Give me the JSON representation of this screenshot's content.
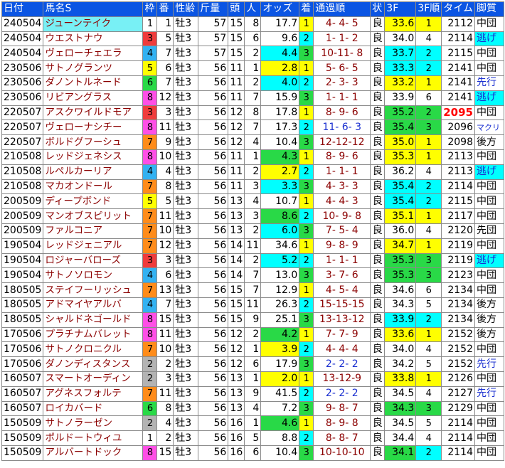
{
  "headers": [
    "日付",
    "馬名S",
    "枠",
    "番",
    "性齢",
    "斤量",
    "頭",
    "人",
    "オッズ",
    "着",
    "通過順",
    "状",
    "3F",
    "3F順",
    "タイム",
    "脚質"
  ],
  "rows": [
    {
      "date": "240504",
      "name": "ジューンテイク",
      "name_hl": true,
      "waku": "1",
      "num": "1",
      "sex": "牡3",
      "kin": "57",
      "tou": "15",
      "jin": "8",
      "odds": "17.7",
      "odds_bg": "",
      "chaku": "1",
      "chaku_bg": "yellow",
      "pass": "4- 4- 5",
      "pass_blue": false,
      "baba": "良",
      "f3": "33.6",
      "f3_bg": "yellow",
      "f3r": "1",
      "f3r_bg": "yellow",
      "time": "2112",
      "time_best": false,
      "style": "中団",
      "style_bg": "",
      "style_blue": false
    },
    {
      "date": "240504",
      "name": "ウエストナウ",
      "name_hl": false,
      "waku": "3",
      "num": "5",
      "sex": "牡3",
      "kin": "57",
      "tou": "15",
      "jin": "6",
      "odds": "9.6",
      "odds_bg": "",
      "chaku": "2",
      "chaku_bg": "cyan",
      "pass": "1- 1- 2",
      "pass_blue": false,
      "baba": "良",
      "f3": "34.0",
      "f3_bg": "",
      "f3r": "4",
      "f3r_bg": "",
      "time": "2114",
      "time_best": false,
      "style": "逃げ",
      "style_bg": "cyan",
      "style_blue": true
    },
    {
      "date": "240504",
      "name": "ヴェローチェエラ",
      "name_hl": false,
      "waku": "4",
      "num": "7",
      "sex": "牡3",
      "kin": "57",
      "tou": "15",
      "jin": "2",
      "odds": "4.4",
      "odds_bg": "cyan",
      "chaku": "3",
      "chaku_bg": "green",
      "pass": "10-11- 8",
      "pass_blue": false,
      "baba": "良",
      "f3": "33.7",
      "f3_bg": "cyan",
      "f3r": "2",
      "f3r_bg": "cyan",
      "time": "2115",
      "time_best": false,
      "style": "中団",
      "style_bg": "",
      "style_blue": false
    },
    {
      "date": "230506",
      "name": "サトノグランツ",
      "name_hl": false,
      "waku": "5",
      "num": "6",
      "sex": "牡3",
      "kin": "56",
      "tou": "11",
      "jin": "1",
      "odds": "2.8",
      "odds_bg": "yellow",
      "chaku": "1",
      "chaku_bg": "yellow",
      "pass": "5- 6- 5",
      "pass_blue": false,
      "baba": "良",
      "f3": "33.3",
      "f3_bg": "cyan",
      "f3r": "2",
      "f3r_bg": "cyan",
      "time": "2141",
      "time_best": false,
      "style": "中団",
      "style_bg": "",
      "style_blue": false
    },
    {
      "date": "230506",
      "name": "ダノントルネード",
      "name_hl": false,
      "waku": "6",
      "num": "7",
      "sex": "牡3",
      "kin": "56",
      "tou": "11",
      "jin": "2",
      "odds": "4.0",
      "odds_bg": "cyan",
      "chaku": "2",
      "chaku_bg": "cyan",
      "pass": "2- 3- 3",
      "pass_blue": false,
      "baba": "良",
      "f3": "33.2",
      "f3_bg": "yellow",
      "f3r": "1",
      "f3r_bg": "yellow",
      "time": "2141",
      "time_best": false,
      "style": "先行",
      "style_bg": "",
      "style_blue": true
    },
    {
      "date": "230506",
      "name": "リビアングラス",
      "name_hl": false,
      "waku": "8",
      "num": "12",
      "sex": "牡3",
      "kin": "56",
      "tou": "11",
      "jin": "7",
      "odds": "15.9",
      "odds_bg": "",
      "chaku": "3",
      "chaku_bg": "green",
      "pass": "1- 1- 1",
      "pass_blue": false,
      "baba": "良",
      "f3": "33.9",
      "f3_bg": "",
      "f3r": "6",
      "f3r_bg": "",
      "time": "2141",
      "time_best": false,
      "style": "逃げ",
      "style_bg": "cyan",
      "style_blue": true
    },
    {
      "date": "220507",
      "name": "アスクワイルドモア",
      "name_hl": false,
      "waku": "3",
      "num": "3",
      "sex": "牡3",
      "kin": "56",
      "tou": "12",
      "jin": "8",
      "odds": "17.8",
      "odds_bg": "",
      "chaku": "1",
      "chaku_bg": "yellow",
      "pass": "8- 9- 6",
      "pass_blue": false,
      "baba": "良",
      "f3": "35.2",
      "f3_bg": "green",
      "f3r": "2",
      "f3r_bg": "green",
      "time": "2095",
      "time_best": true,
      "style": "中団",
      "style_bg": "",
      "style_blue": false
    },
    {
      "date": "220507",
      "name": "ヴェローナシチー",
      "name_hl": false,
      "waku": "8",
      "num": "11",
      "sex": "牡3",
      "kin": "56",
      "tou": "12",
      "jin": "7",
      "odds": "17.3",
      "odds_bg": "",
      "chaku": "2",
      "chaku_bg": "cyan",
      "pass": "11- 6- 3",
      "pass_blue": true,
      "baba": "良",
      "f3": "35.4",
      "f3_bg": "green",
      "f3r": "3",
      "f3r_bg": "green",
      "time": "2096",
      "time_best": false,
      "style": "マクリ",
      "style_bg": "",
      "style_blue": true,
      "style_sm": true
    },
    {
      "date": "220507",
      "name": "ボルドグフーシュ",
      "name_hl": false,
      "waku": "7",
      "num": "9",
      "sex": "牡3",
      "kin": "56",
      "tou": "12",
      "jin": "4",
      "odds": "10.4",
      "odds_bg": "",
      "chaku": "3",
      "chaku_bg": "green",
      "pass": "12-12-12",
      "pass_blue": false,
      "baba": "良",
      "f3": "35.0",
      "f3_bg": "yellow",
      "f3r": "1",
      "f3r_bg": "yellow",
      "time": "2098",
      "time_best": false,
      "style": "後方",
      "style_bg": "",
      "style_blue": false
    },
    {
      "date": "210508",
      "name": "レッドジェネシス",
      "name_hl": false,
      "waku": "8",
      "num": "10",
      "sex": "牡3",
      "kin": "56",
      "tou": "11",
      "jin": "1",
      "odds": "4.3",
      "odds_bg": "green",
      "chaku": "1",
      "chaku_bg": "yellow",
      "pass": "8- 9- 6",
      "pass_blue": false,
      "baba": "良",
      "f3": "35.3",
      "f3_bg": "yellow",
      "f3r": "1",
      "f3r_bg": "yellow",
      "time": "2113",
      "time_best": false,
      "style": "中団",
      "style_bg": "",
      "style_blue": false
    },
    {
      "date": "210508",
      "name": "ルペルカーリア",
      "name_hl": false,
      "waku": "4",
      "num": "4",
      "sex": "牡3",
      "kin": "56",
      "tou": "11",
      "jin": "2",
      "odds": "2.7",
      "odds_bg": "yellow",
      "chaku": "2",
      "chaku_bg": "cyan",
      "pass": "1- 1- 1",
      "pass_blue": false,
      "baba": "良",
      "f3": "36.2",
      "f3_bg": "",
      "f3r": "4",
      "f3r_bg": "",
      "time": "2113",
      "time_best": false,
      "style": "逃げ",
      "style_bg": "cyan",
      "style_blue": true
    },
    {
      "date": "210508",
      "name": "マカオンドール",
      "name_hl": false,
      "waku": "7",
      "num": "8",
      "sex": "牡3",
      "kin": "56",
      "tou": "11",
      "jin": "3",
      "odds": "3.3",
      "odds_bg": "cyan",
      "chaku": "3",
      "chaku_bg": "green",
      "pass": "4- 3- 3",
      "pass_blue": false,
      "baba": "良",
      "f3": "35.4",
      "f3_bg": "cyan",
      "f3r": "2",
      "f3r_bg": "cyan",
      "time": "2114",
      "time_best": false,
      "style": "中団",
      "style_bg": "",
      "style_blue": false
    },
    {
      "date": "200509",
      "name": "ディープボンド",
      "name_hl": false,
      "waku": "5",
      "num": "5",
      "sex": "牡3",
      "kin": "56",
      "tou": "13",
      "jin": "4",
      "odds": "10.7",
      "odds_bg": "",
      "chaku": "1",
      "chaku_bg": "yellow",
      "pass": "4- 4- 3",
      "pass_blue": false,
      "baba": "良",
      "f3": "35.4",
      "f3_bg": "cyan",
      "f3r": "2",
      "f3r_bg": "cyan",
      "time": "2115",
      "time_best": false,
      "style": "中団",
      "style_bg": "",
      "style_blue": false
    },
    {
      "date": "200509",
      "name": "マンオブスピリット",
      "name_hl": false,
      "waku": "7",
      "num": "11",
      "sex": "牡3",
      "kin": "56",
      "tou": "13",
      "jin": "3",
      "odds": "8.6",
      "odds_bg": "green",
      "chaku": "2",
      "chaku_bg": "cyan",
      "pass": "10- 9- 8",
      "pass_blue": false,
      "baba": "良",
      "f3": "35.1",
      "f3_bg": "yellow",
      "f3r": "1",
      "f3r_bg": "yellow",
      "time": "2117",
      "time_best": false,
      "style": "中団",
      "style_bg": "",
      "style_blue": false
    },
    {
      "date": "200509",
      "name": "ファルコニア",
      "name_hl": false,
      "waku": "7",
      "num": "10",
      "sex": "牡3",
      "kin": "56",
      "tou": "13",
      "jin": "2",
      "odds": "6.0",
      "odds_bg": "cyan",
      "chaku": "3",
      "chaku_bg": "green",
      "pass": "7- 5- 4",
      "pass_blue": false,
      "baba": "良",
      "f3": "36.0",
      "f3_bg": "",
      "f3r": "4",
      "f3r_bg": "",
      "time": "2120",
      "time_best": false,
      "style": "先団",
      "style_bg": "",
      "style_blue": false
    },
    {
      "date": "190504",
      "name": "レッドジェニアル",
      "name_hl": false,
      "waku": "7",
      "num": "12",
      "sex": "牡3",
      "kin": "56",
      "tou": "14",
      "jin": "11",
      "odds": "34.6",
      "odds_bg": "",
      "chaku": "1",
      "chaku_bg": "yellow",
      "pass": "9- 8- 9",
      "pass_blue": false,
      "baba": "良",
      "f3": "34.7",
      "f3_bg": "yellow",
      "f3r": "1",
      "f3r_bg": "yellow",
      "time": "2119",
      "time_best": false,
      "style": "中団",
      "style_bg": "",
      "style_blue": false
    },
    {
      "date": "190504",
      "name": "ロジャーバローズ",
      "name_hl": false,
      "waku": "3",
      "num": "3",
      "sex": "牡3",
      "kin": "56",
      "tou": "14",
      "jin": "2",
      "odds": "5.2",
      "odds_bg": "cyan",
      "chaku": "2",
      "chaku_bg": "cyan",
      "pass": "1- 1- 1",
      "pass_blue": false,
      "baba": "良",
      "f3": "35.3",
      "f3_bg": "green",
      "f3r": "3",
      "f3r_bg": "green",
      "time": "2119",
      "time_best": false,
      "style": "逃げ",
      "style_bg": "cyan",
      "style_blue": true
    },
    {
      "date": "190504",
      "name": "サトノソロモン",
      "name_hl": false,
      "waku": "4",
      "num": "6",
      "sex": "牡3",
      "kin": "56",
      "tou": "14",
      "jin": "7",
      "odds": "13.0",
      "odds_bg": "",
      "chaku": "3",
      "chaku_bg": "green",
      "pass": "3- 7- 6",
      "pass_blue": false,
      "baba": "良",
      "f3": "35.3",
      "f3_bg": "green",
      "f3r": "3",
      "f3r_bg": "green",
      "time": "2123",
      "time_best": false,
      "style": "中団",
      "style_bg": "",
      "style_blue": false
    },
    {
      "date": "180505",
      "name": "ステイフーリッシュ",
      "name_hl": false,
      "waku": "7",
      "num": "13",
      "sex": "牡3",
      "kin": "56",
      "tou": "15",
      "jin": "7",
      "odds": "12.9",
      "odds_bg": "",
      "chaku": "1",
      "chaku_bg": "yellow",
      "pass": "4- 5- 4",
      "pass_blue": false,
      "baba": "良",
      "f3": "34.6",
      "f3_bg": "",
      "f3r": "6",
      "f3r_bg": "",
      "time": "2134",
      "time_best": false,
      "style": "中団",
      "style_bg": "",
      "style_blue": false
    },
    {
      "date": "180505",
      "name": "アドマイヤアルバ",
      "name_hl": false,
      "waku": "4",
      "num": "7",
      "sex": "牡3",
      "kin": "56",
      "tou": "15",
      "jin": "11",
      "odds": "26.3",
      "odds_bg": "",
      "chaku": "2",
      "chaku_bg": "cyan",
      "pass": "15-15-15",
      "pass_blue": false,
      "baba": "良",
      "f3": "34.3",
      "f3_bg": "",
      "f3r": "5",
      "f3r_bg": "",
      "time": "2134",
      "time_best": false,
      "style": "後方",
      "style_bg": "",
      "style_blue": false
    },
    {
      "date": "180505",
      "name": "シャルドネゴールド",
      "name_hl": false,
      "waku": "8",
      "num": "15",
      "sex": "牡3",
      "kin": "56",
      "tou": "15",
      "jin": "9",
      "odds": "25.1",
      "odds_bg": "",
      "chaku": "3",
      "chaku_bg": "green",
      "pass": "13-13-12",
      "pass_blue": false,
      "baba": "良",
      "f3": "33.9",
      "f3_bg": "cyan",
      "f3r": "2",
      "f3r_bg": "cyan",
      "time": "2134",
      "time_best": false,
      "style": "後方",
      "style_bg": "",
      "style_blue": false
    },
    {
      "date": "170506",
      "name": "プラチナムバレット",
      "name_hl": false,
      "waku": "8",
      "num": "11",
      "sex": "牡3",
      "kin": "56",
      "tou": "12",
      "jin": "2",
      "odds": "4.2",
      "odds_bg": "green",
      "chaku": "1",
      "chaku_bg": "yellow",
      "pass": "7- 7- 9",
      "pass_blue": false,
      "baba": "良",
      "f3": "33.6",
      "f3_bg": "yellow",
      "f3r": "1",
      "f3r_bg": "yellow",
      "time": "2152",
      "time_best": false,
      "style": "後方",
      "style_bg": "",
      "style_blue": false
    },
    {
      "date": "170506",
      "name": "サトノクロニクル",
      "name_hl": false,
      "waku": "7",
      "num": "10",
      "sex": "牡3",
      "kin": "56",
      "tou": "12",
      "jin": "1",
      "odds": "3.9",
      "odds_bg": "yellow",
      "chaku": "2",
      "chaku_bg": "cyan",
      "pass": "4- 4- 4",
      "pass_blue": false,
      "baba": "良",
      "f3": "34.0",
      "f3_bg": "",
      "f3r": "4",
      "f3r_bg": "",
      "time": "2152",
      "time_best": false,
      "style": "中団",
      "style_bg": "",
      "style_blue": false
    },
    {
      "date": "170506",
      "name": "ダノンディスタンス",
      "name_hl": false,
      "waku": "2",
      "num": "2",
      "sex": "牡3",
      "kin": "56",
      "tou": "12",
      "jin": "6",
      "odds": "17.9",
      "odds_bg": "",
      "chaku": "3",
      "chaku_bg": "green",
      "pass": "2- 2- 2",
      "pass_blue": true,
      "baba": "良",
      "f3": "34.2",
      "f3_bg": "",
      "f3r": "5",
      "f3r_bg": "",
      "time": "2152",
      "time_best": false,
      "style": "先行",
      "style_bg": "",
      "style_blue": true
    },
    {
      "date": "160507",
      "name": "スマートオーディン",
      "name_hl": false,
      "waku": "2",
      "num": "3",
      "sex": "牡3",
      "kin": "56",
      "tou": "13",
      "jin": "1",
      "odds": "2.0",
      "odds_bg": "yellow",
      "chaku": "1",
      "chaku_bg": "yellow",
      "pass": "13-12-9",
      "pass_blue": false,
      "baba": "良",
      "f3": "33.8",
      "f3_bg": "yellow",
      "f3r": "1",
      "f3r_bg": "yellow",
      "time": "2126",
      "time_best": false,
      "style": "中団",
      "style_bg": "",
      "style_blue": false
    },
    {
      "date": "160507",
      "name": "アグネスフォルテ",
      "name_hl": false,
      "waku": "7",
      "num": "11",
      "sex": "牡3",
      "kin": "56",
      "tou": "13",
      "jin": "9",
      "odds": "41.5",
      "odds_bg": "",
      "chaku": "2",
      "chaku_bg": "cyan",
      "pass": "2- 2- 2",
      "pass_blue": true,
      "baba": "良",
      "f3": "34.5",
      "f3_bg": "",
      "f3r": "4",
      "f3r_bg": "",
      "time": "2127",
      "time_best": false,
      "style": "先行",
      "style_bg": "",
      "style_blue": true
    },
    {
      "date": "160507",
      "name": "ロイカバード",
      "name_hl": false,
      "waku": "6",
      "num": "8",
      "sex": "牡3",
      "kin": "56",
      "tou": "13",
      "jin": "4",
      "odds": "7.2",
      "odds_bg": "",
      "chaku": "3",
      "chaku_bg": "green",
      "pass": "9- 8- 7",
      "pass_blue": false,
      "baba": "良",
      "f3": "34.3",
      "f3_bg": "green",
      "f3r": "3",
      "f3r_bg": "green",
      "time": "2129",
      "time_best": false,
      "style": "中団",
      "style_bg": "",
      "style_blue": false
    },
    {
      "date": "150509",
      "name": "サトノラーゼン",
      "name_hl": false,
      "waku": "2",
      "num": "4",
      "sex": "牡3",
      "kin": "56",
      "tou": "16",
      "jin": "1",
      "odds": "4.6",
      "odds_bg": "green",
      "chaku": "1",
      "chaku_bg": "yellow",
      "pass": "8- 9- 8",
      "pass_blue": false,
      "baba": "良",
      "f3": "34.5",
      "f3_bg": "",
      "f3r": "5",
      "f3r_bg": "",
      "time": "2114",
      "time_best": false,
      "style": "中団",
      "style_bg": "",
      "style_blue": false
    },
    {
      "date": "150509",
      "name": "ポルドートウィユ",
      "name_hl": false,
      "waku": "1",
      "num": "2",
      "sex": "牡3",
      "kin": "56",
      "tou": "16",
      "jin": "5",
      "odds": "8.8",
      "odds_bg": "",
      "chaku": "2",
      "chaku_bg": "cyan",
      "pass": "8- 8- 7",
      "pass_blue": false,
      "baba": "良",
      "f3": "34.4",
      "f3_bg": "",
      "f3r": "4",
      "f3r_bg": "",
      "time": "2114",
      "time_best": false,
      "style": "中団",
      "style_bg": "",
      "style_blue": false
    },
    {
      "date": "150509",
      "name": "アルバートドック",
      "name_hl": false,
      "waku": "8",
      "num": "15",
      "sex": "牡3",
      "kin": "56",
      "tou": "16",
      "jin": "6",
      "odds": "10.4",
      "odds_bg": "",
      "chaku": "3",
      "chaku_bg": "green",
      "pass": "10-10-10",
      "pass_blue": false,
      "baba": "良",
      "f3": "34.1",
      "f3_bg": "green",
      "f3r": "2",
      "f3r_bg": "cyan",
      "time": "2114",
      "time_best": false,
      "style": "中団",
      "style_bg": "",
      "style_blue": false
    }
  ],
  "colors": {
    "header_bg": "#0b55e3",
    "header_fg": "#ffffff",
    "name_fg": "#8b0000",
    "highlight_yellow": "#ffff00",
    "highlight_cyan": "#00ffff",
    "highlight_green": "#29d947",
    "best_time": "#ff0000"
  }
}
